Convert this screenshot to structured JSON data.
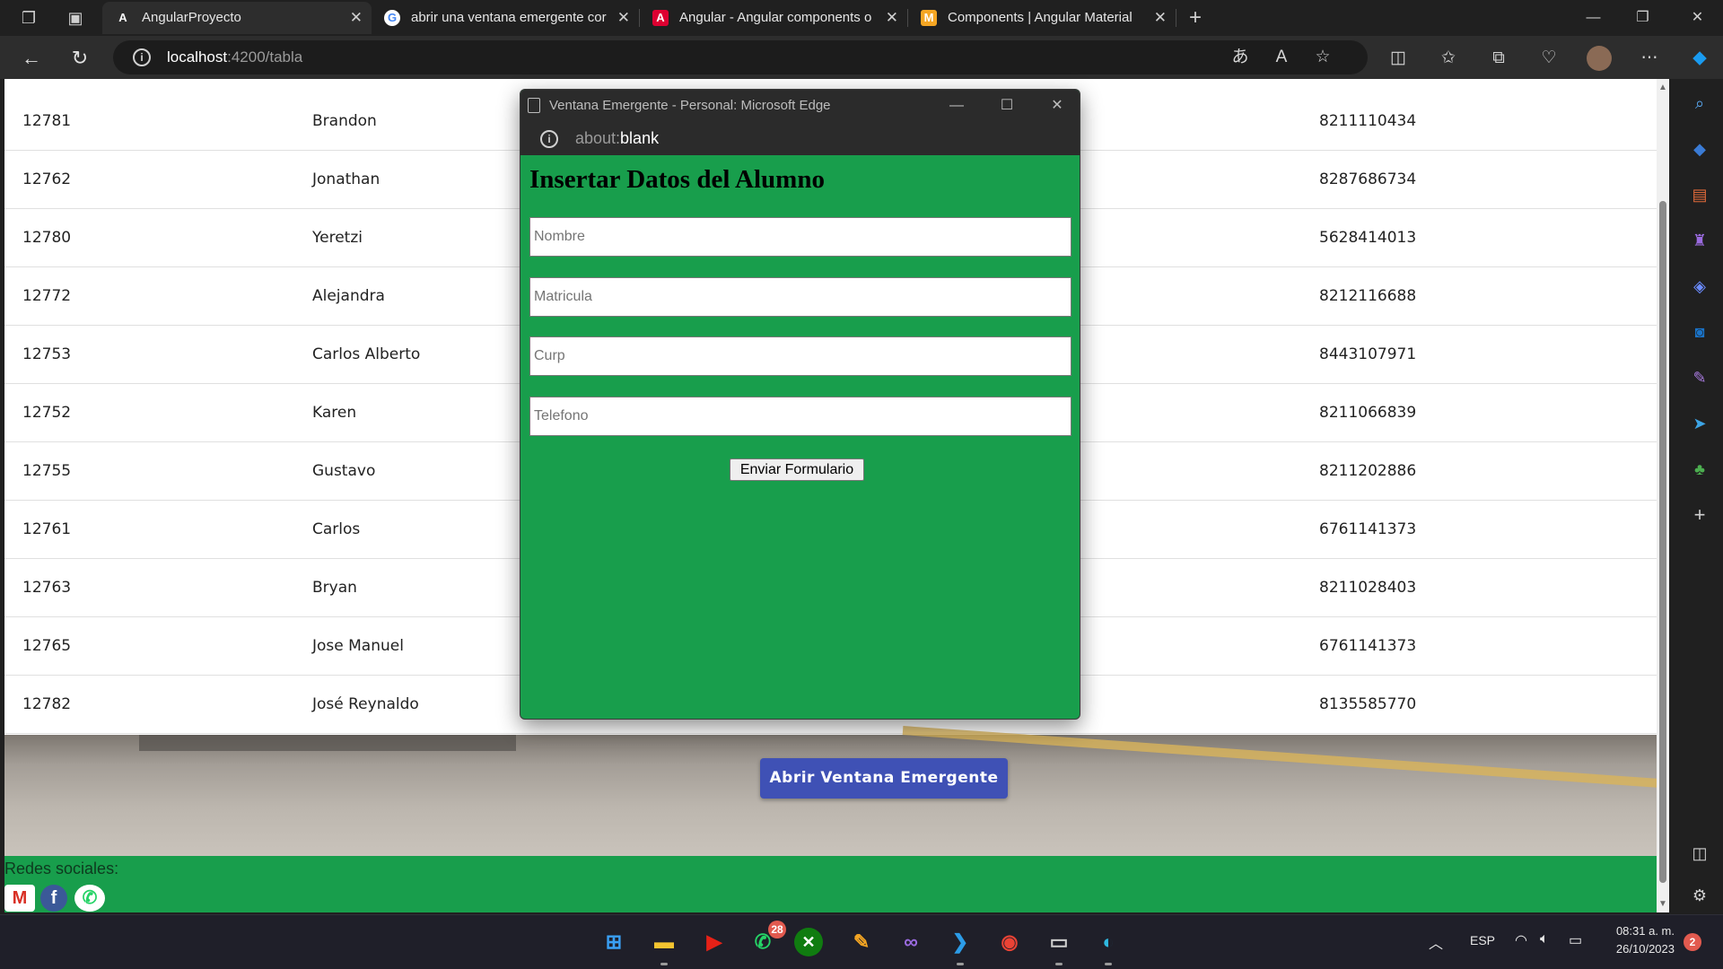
{
  "browser": {
    "tabs": [
      {
        "label": "AngularProyecto",
        "favicon": "A",
        "favicon_color": "#ffffff",
        "favicon_bg": "#202020"
      },
      {
        "label": "abrir una ventana emergente cor",
        "favicon": "G",
        "favicon_color": "#4285f4",
        "favicon_bg": "#ffffff"
      },
      {
        "label": "Angular - Angular components o",
        "favicon": "A",
        "favicon_color": "#ffffff",
        "favicon_bg": "#dd0031"
      },
      {
        "label": "Components | Angular Material",
        "favicon": "M",
        "favicon_color": "#ffffff",
        "favicon_bg": "#f5a623"
      }
    ],
    "new_tab_symbol": "+",
    "url_host": "localhost",
    "url_path": ":4200/tabla"
  },
  "table": {
    "rows": [
      {
        "id": "12781",
        "name": "Brandon",
        "phone": "8211110434"
      },
      {
        "id": "12762",
        "name": "Jonathan",
        "phone": "8287686734"
      },
      {
        "id": "12780",
        "name": "Yeretzi",
        "phone": "5628414013"
      },
      {
        "id": "12772",
        "name": "Alejandra",
        "phone": "8212116688"
      },
      {
        "id": "12753",
        "name": "Carlos Alberto",
        "phone": "8443107971"
      },
      {
        "id": "12752",
        "name": "Karen",
        "phone": "8211066839"
      },
      {
        "id": "12755",
        "name": "Gustavo",
        "phone": "8211202886"
      },
      {
        "id": "12761",
        "name": "Carlos",
        "phone": "6761141373"
      },
      {
        "id": "12763",
        "name": "Bryan",
        "phone": "8211028403"
      },
      {
        "id": "12765",
        "name": "Jose Manuel",
        "phone": "6761141373"
      },
      {
        "id": "12782",
        "name": "José Reynaldo",
        "phone": "8135585770"
      }
    ]
  },
  "page": {
    "open_popup_label": "Abrir Ventana Emergente",
    "footer_title": "Redes sociales:"
  },
  "popup": {
    "window_title": "Ventana Emergente - Personal: Microsoft Edge",
    "url_scheme": "about:",
    "url_host": "blank",
    "form_title": "Insertar Datos del Alumno",
    "fields": [
      {
        "placeholder": "Nombre",
        "value": ""
      },
      {
        "placeholder": "Matricula",
        "value": ""
      },
      {
        "placeholder": "Curp",
        "value": ""
      },
      {
        "placeholder": "Telefono",
        "value": ""
      }
    ],
    "submit_label": "Enviar Formulario"
  },
  "taskbar": {
    "whatsapp_badge": "28",
    "language": "ESP",
    "time": "08:31 a. m.",
    "date": "26/10/2023",
    "notifications": "2"
  },
  "colors": {
    "green": "#189e4c",
    "indigo": "#3f51b5"
  }
}
